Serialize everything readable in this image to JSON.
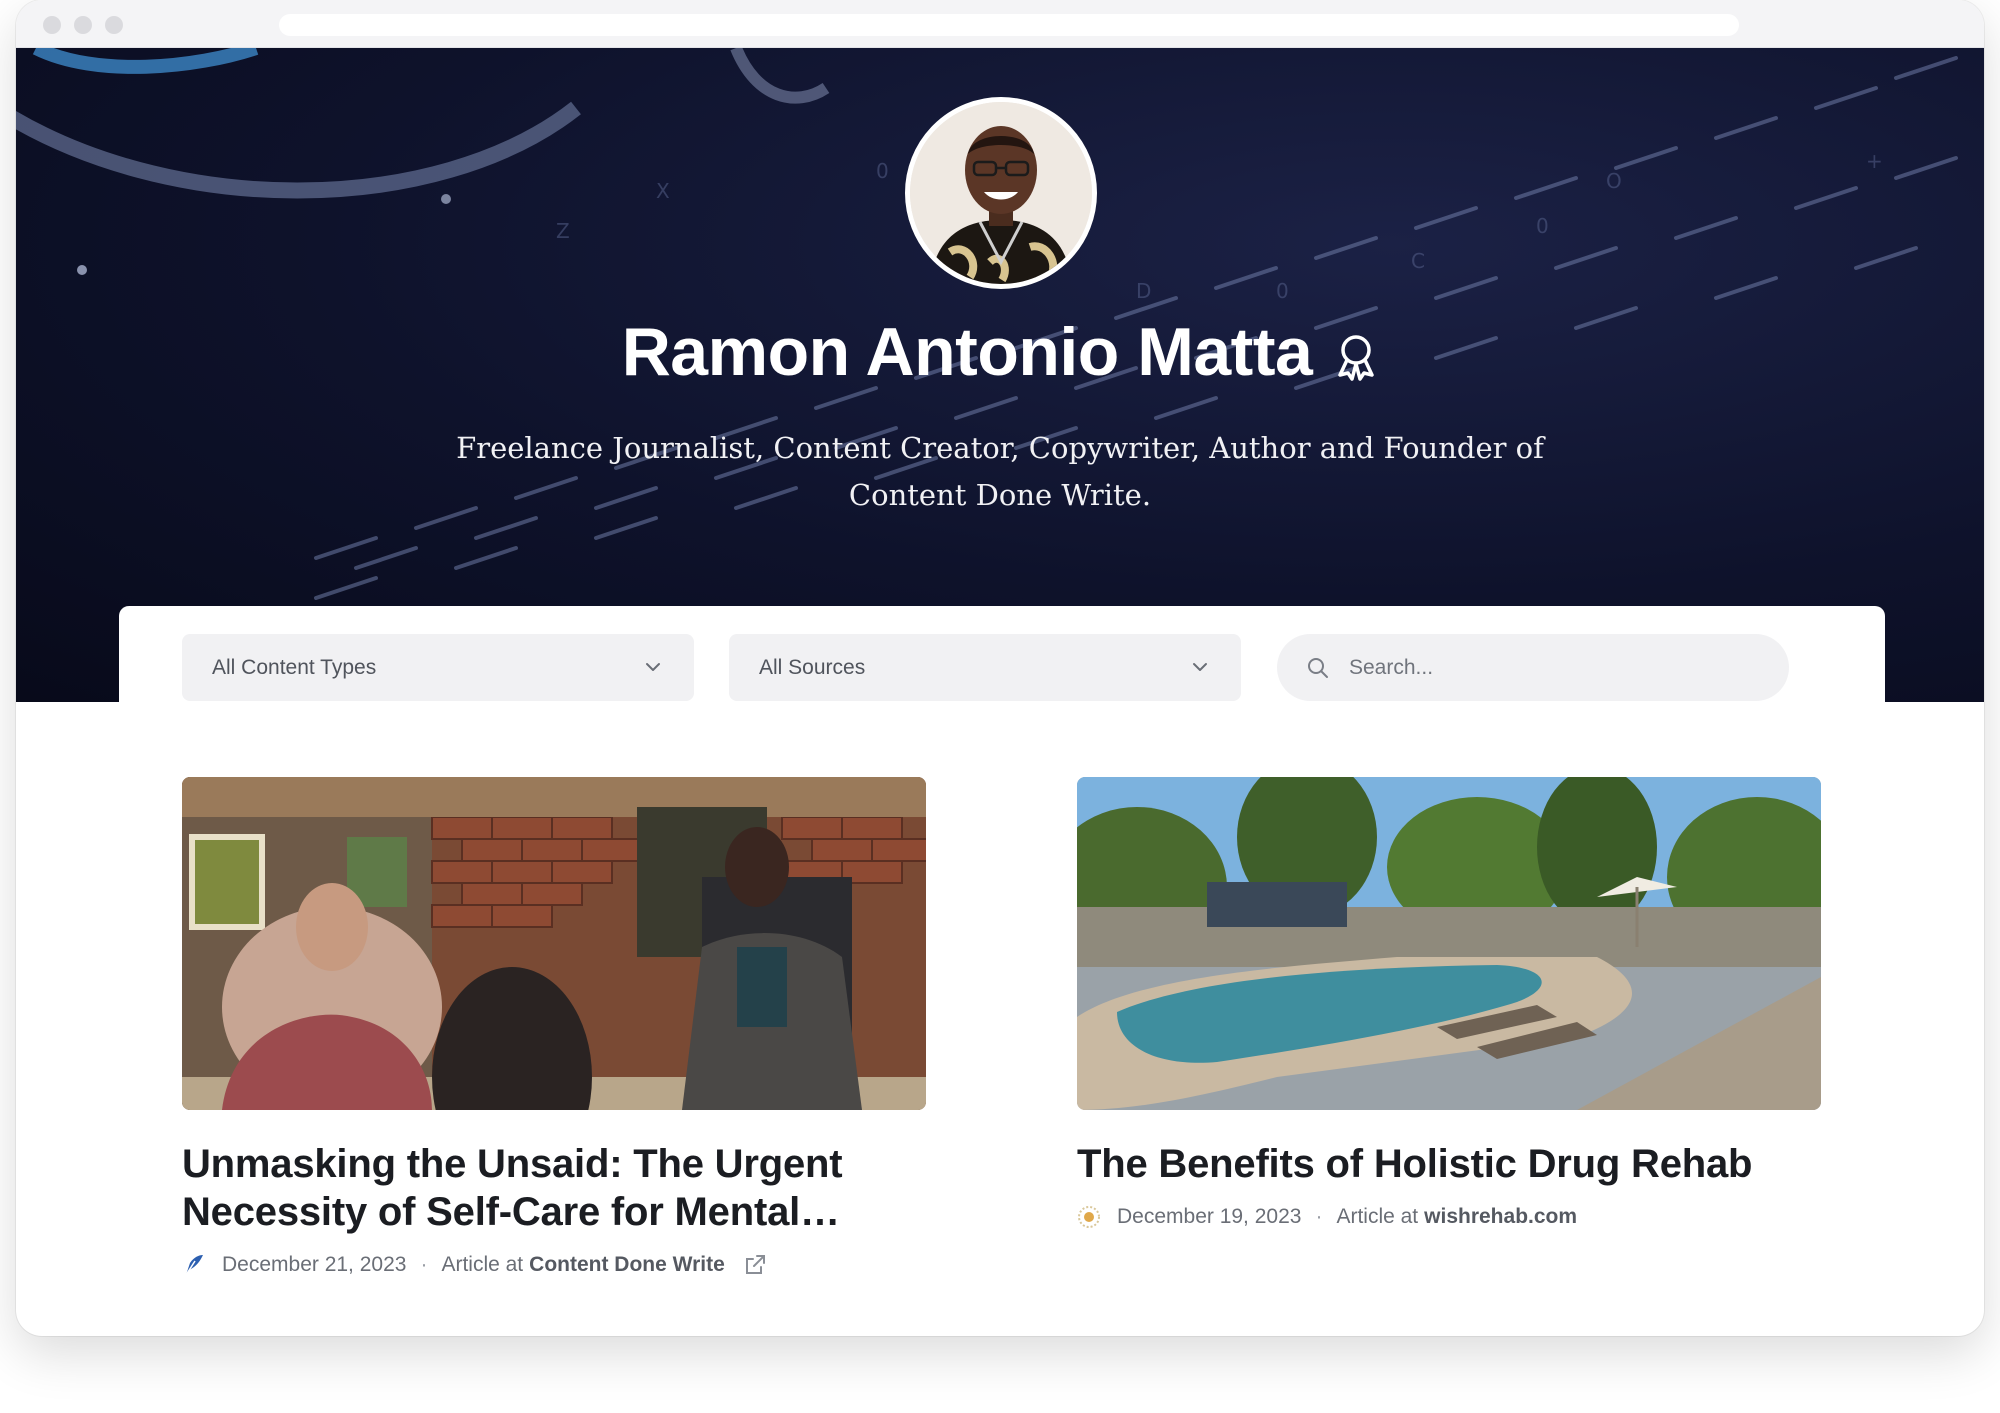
{
  "profile": {
    "name": "Ramon Antonio Matta",
    "bio": "Freelance Journalist, Content Creator, Copywriter, Author and Founder of Content Done Write.",
    "badge_icon": "award-ribbon-icon"
  },
  "filters": {
    "content_types": {
      "selected": "All Content Types"
    },
    "sources": {
      "selected": "All Sources"
    },
    "search": {
      "placeholder": "Search...",
      "value": ""
    }
  },
  "articles": [
    {
      "title": "Unmasking the Unsaid: The Urgent Necessity of Self-Care for Mental…",
      "date": "December 21, 2023",
      "type_prefix": "Article at",
      "source": "Content Done Write",
      "source_icon": "quill-icon",
      "external_icon": "external-link-icon"
    },
    {
      "title": "The Benefits of Holistic Drug Rehab",
      "date": "December 19, 2023",
      "type_prefix": "Article at",
      "source": "wishrehab.com",
      "source_icon": "sun-logo-icon"
    }
  ],
  "colors": {
    "hero_bg": "#0e122b",
    "card_title": "#1b1d22",
    "meta_text": "#6a6e76",
    "input_bg": "#f1f1f3"
  }
}
